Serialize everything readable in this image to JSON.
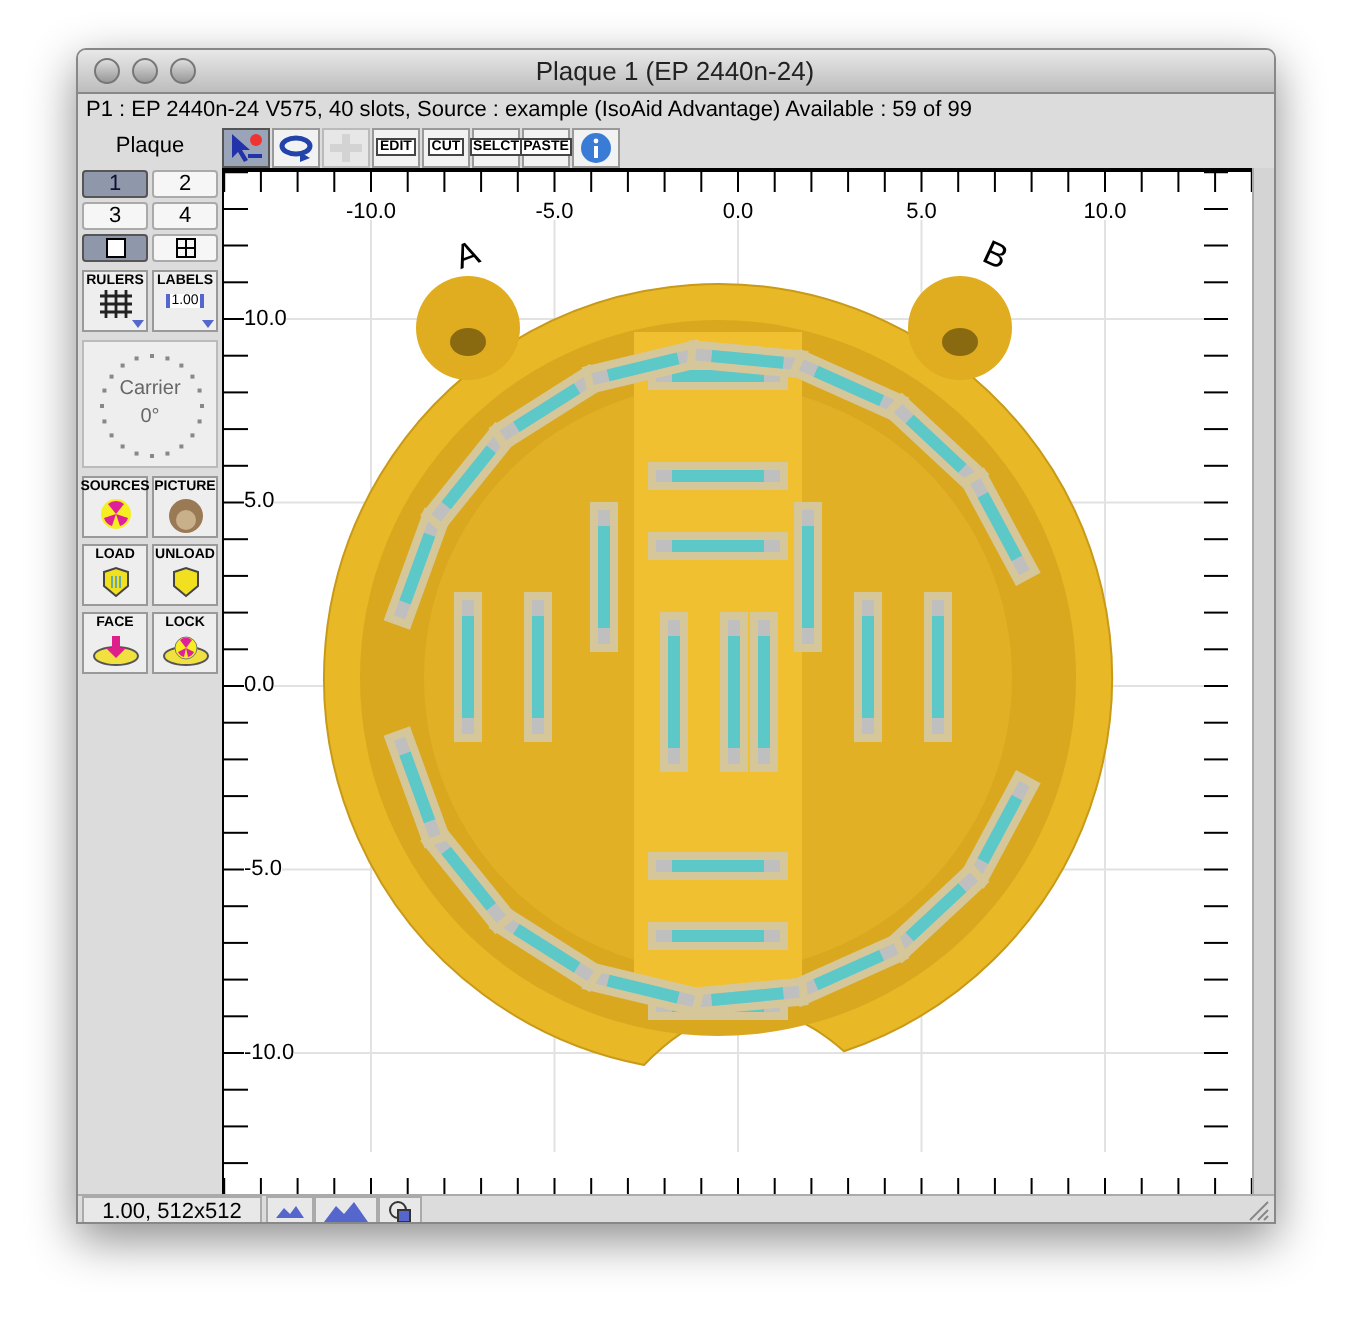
{
  "window": {
    "title": "Plaque 1 (EP 2440n-24)"
  },
  "info_line": "P1 : EP 2440n-24 V575, 40 slots, Source : example (IsoAid Advantage) Available : 59 of 99",
  "panel_label": "Plaque",
  "toolbar": [
    {
      "kind": "pointer",
      "selected": true,
      "disabled": false
    },
    {
      "kind": "rotate",
      "selected": false,
      "disabled": false
    },
    {
      "kind": "move",
      "selected": false,
      "disabled": true
    },
    {
      "kind": "text",
      "label": "EDIT",
      "selected": false,
      "disabled": false
    },
    {
      "kind": "text",
      "label": "CUT",
      "selected": false,
      "disabled": false
    },
    {
      "kind": "text",
      "label": "SELCT",
      "selected": false,
      "disabled": false
    },
    {
      "kind": "text",
      "label": "PASTE",
      "selected": false,
      "disabled": false
    },
    {
      "kind": "info",
      "selected": false,
      "disabled": false
    }
  ],
  "plaque_buttons": [
    {
      "label": "1",
      "selected": true
    },
    {
      "label": "2",
      "selected": false
    },
    {
      "label": "3",
      "selected": false
    },
    {
      "label": "4",
      "selected": false
    }
  ],
  "view_buttons": [
    {
      "kind": "single",
      "selected": true
    },
    {
      "kind": "grid",
      "selected": false
    }
  ],
  "tools_top": [
    {
      "kind": "rulers",
      "label": "RULERS"
    },
    {
      "kind": "labels",
      "label": "LABELS",
      "sublabel": "1.00"
    }
  ],
  "carrier": {
    "label": "Carrier",
    "angle": "0°"
  },
  "tools_bottom": [
    {
      "kind": "sources",
      "label": "SOURCES"
    },
    {
      "kind": "picture",
      "label": "PICTURE"
    },
    {
      "kind": "load",
      "label": "LOAD"
    },
    {
      "kind": "unload",
      "label": "UNLOAD"
    },
    {
      "kind": "face",
      "label": "FACE"
    },
    {
      "kind": "lock",
      "label": "LOCK"
    }
  ],
  "canvas": {
    "x_labels": [
      "-10.0",
      "-5.0",
      "0.0",
      "5.0",
      "10.0"
    ],
    "y_labels": [
      "10.0",
      "5.0",
      "0.0",
      "-5.0",
      "-10.0"
    ],
    "markers": [
      "A",
      "B"
    ]
  },
  "status_bar": {
    "text": "1.00, 512x512",
    "buttons": [
      {
        "kind": "small-peaks"
      },
      {
        "kind": "large-peaks"
      },
      {
        "kind": "copy"
      }
    ]
  }
}
